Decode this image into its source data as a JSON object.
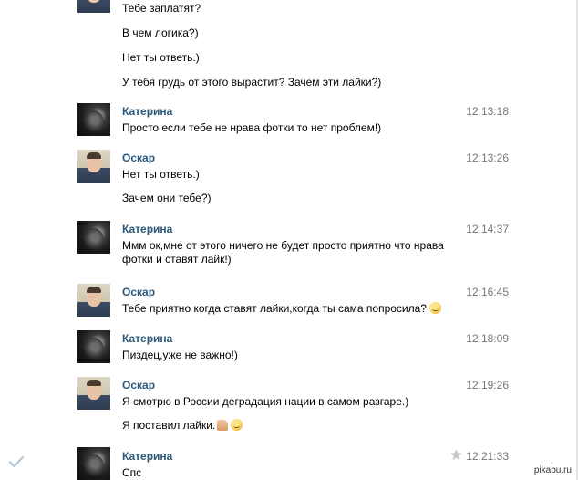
{
  "messages": [
    {
      "author": "",
      "time": "",
      "avatar": "light",
      "lines": [
        "Тебе заплатят?",
        "В чем логика?)",
        "Нет ты ответь.)",
        "У тебя грудь от этого вырастит? Зачем эти лайки?)"
      ]
    },
    {
      "author": "Катерина",
      "time": "12:13:18",
      "avatar": "dark",
      "lines": [
        "Просто если тебе не нрава фотки то нет проблем!)"
      ]
    },
    {
      "author": "Оскар",
      "time": "12:13:26",
      "avatar": "light",
      "lines": [
        "Нет ты ответь.)",
        "Зачем они тебе?)"
      ]
    },
    {
      "author": "Катерина",
      "time": "12:14:37",
      "avatar": "dark",
      "lines": [
        "Ммм ок,мне от этого ничего не будет просто приятно что нрава фотки и ставят лайк!)"
      ]
    },
    {
      "author": "Оскар",
      "time": "12:16:45",
      "avatar": "light",
      "lines": [
        "Тебе приятно когда ставят лайки,когда ты сама попросила?"
      ]
    },
    {
      "author": "Катерина",
      "time": "12:18:09",
      "avatar": "dark",
      "lines": [
        "Пиздец,уже не важно!)"
      ]
    },
    {
      "author": "Оскар",
      "time": "12:19:26",
      "avatar": "light",
      "lines": [
        "Я смотрю в России деградация нации в самом разгаре.)",
        "Я поставил лайки."
      ]
    },
    {
      "author": "Катерина",
      "time": "12:21:33",
      "avatar": "dark",
      "lines": [
        "Спс"
      ]
    }
  ],
  "icons": {
    "check": "check-icon",
    "star": "star-icon",
    "smile": "smile-emoji",
    "thumbs_up": "thumbs-up-emoji",
    "wink": "wink-emoji"
  },
  "colors": {
    "author_name": "#2b587a",
    "timestamp": "#777777",
    "background": "#ffffff"
  },
  "watermark": "pikabu.ru"
}
